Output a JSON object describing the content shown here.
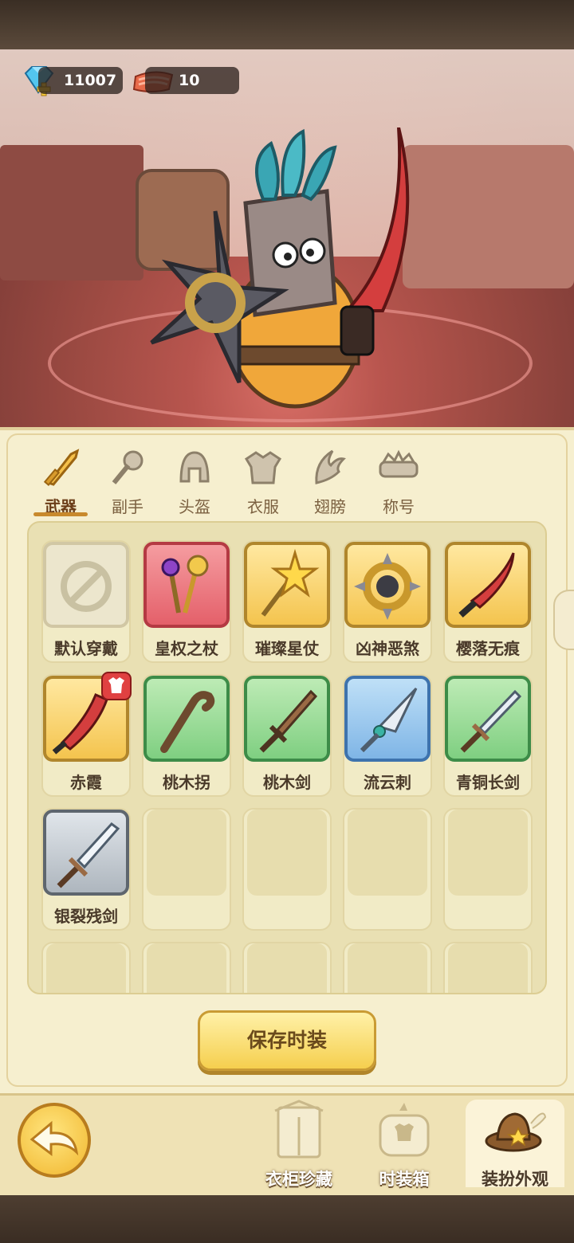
{
  "currency": {
    "gems": "11007",
    "meat": "10"
  },
  "tabs": [
    {
      "label": "武器",
      "icon": "sword-icon",
      "active": true
    },
    {
      "label": "副手",
      "icon": "offhand-icon",
      "active": false
    },
    {
      "label": "头盔",
      "icon": "helmet-icon",
      "active": false
    },
    {
      "label": "衣服",
      "icon": "armor-icon",
      "active": false
    },
    {
      "label": "翅膀",
      "icon": "wings-icon",
      "active": false
    },
    {
      "label": "称号",
      "icon": "title-icon",
      "active": false
    }
  ],
  "items": [
    {
      "name": "默认穿戴",
      "rarity": "none",
      "icon": "default-none-icon"
    },
    {
      "name": "皇权之杖",
      "rarity": "red",
      "icon": "scepter-icon"
    },
    {
      "name": "璀璨星仗",
      "rarity": "gold",
      "icon": "star-staff-icon"
    },
    {
      "name": "凶神恶煞",
      "rarity": "gold",
      "icon": "spiked-ring-icon"
    },
    {
      "name": "樱落无痕",
      "rarity": "gold",
      "icon": "red-katana-icon"
    },
    {
      "name": "赤霞",
      "rarity": "gold",
      "icon": "red-blade-icon",
      "badge": "outfit-badge-icon"
    },
    {
      "name": "桃木拐",
      "rarity": "green",
      "icon": "wooden-cane-icon"
    },
    {
      "name": "桃木剑",
      "rarity": "green",
      "icon": "wooden-sword-icon"
    },
    {
      "name": "流云刺",
      "rarity": "blue",
      "icon": "dagger-icon"
    },
    {
      "name": "青铜长剑",
      "rarity": "green",
      "icon": "bronze-sword-icon"
    },
    {
      "name": "银裂残剑",
      "rarity": "gray",
      "icon": "silver-sword-icon"
    }
  ],
  "save_label": "保存时装",
  "nav": [
    {
      "label": "衣柜珍藏",
      "icon": "wardrobe-icon",
      "active": false
    },
    {
      "label": "时装箱",
      "icon": "fashion-box-icon",
      "active": false
    },
    {
      "label": "装扮外观",
      "icon": "hat-icon",
      "active": true
    }
  ]
}
